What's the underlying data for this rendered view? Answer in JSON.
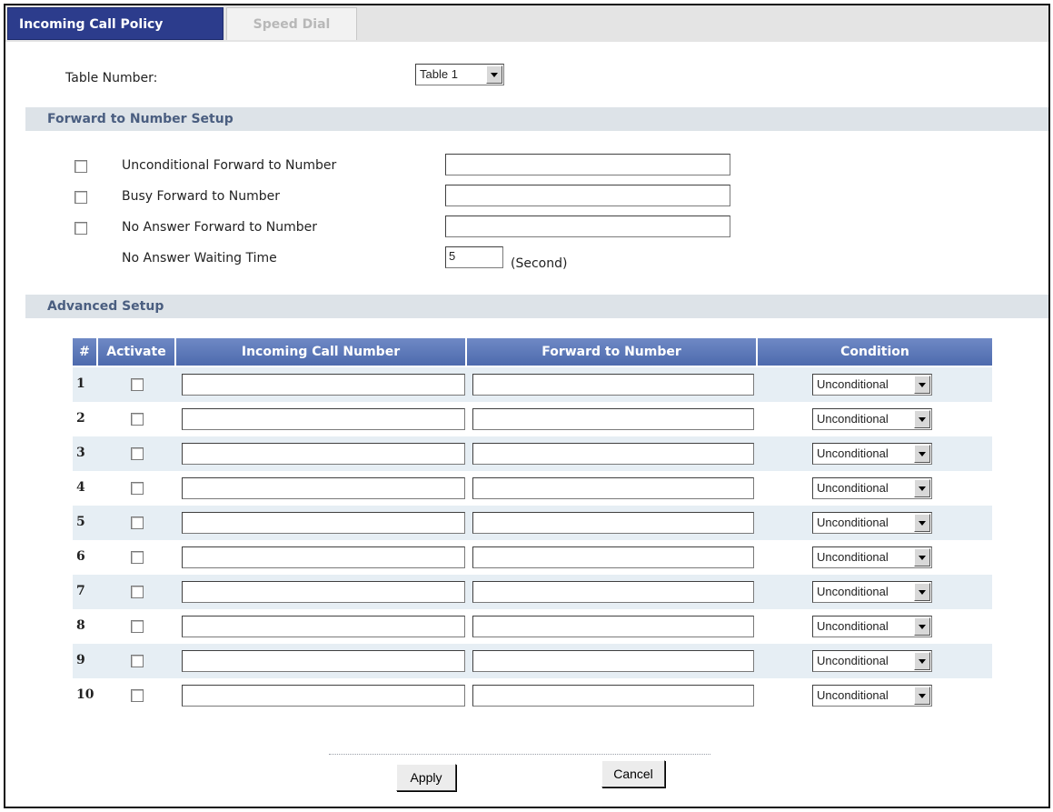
{
  "tabs": [
    {
      "label": "Incoming Call Policy",
      "active": true
    },
    {
      "label": "Speed Dial",
      "active": false
    }
  ],
  "table_number": {
    "label": "Table Number:",
    "value": "Table 1"
  },
  "forward_section": {
    "title": "Forward to Number Setup",
    "unconditional_label": "Unconditional Forward to Number",
    "busy_label": "Busy Forward to Number",
    "no_answer_label": "No Answer Forward to Number",
    "wait_label": "No Answer Waiting Time",
    "wait_value": "5",
    "wait_unit": "(Second)"
  },
  "advanced_section": {
    "title": "Advanced Setup",
    "columns": [
      "#",
      "Activate",
      "Incoming Call Number",
      "Forward to Number",
      "Condition"
    ],
    "rows": [
      {
        "num": "1",
        "condition": "Unconditional"
      },
      {
        "num": "2",
        "condition": "Unconditional"
      },
      {
        "num": "3",
        "condition": "Unconditional"
      },
      {
        "num": "4",
        "condition": "Unconditional"
      },
      {
        "num": "5",
        "condition": "Unconditional"
      },
      {
        "num": "6",
        "condition": "Unconditional"
      },
      {
        "num": "7",
        "condition": "Unconditional"
      },
      {
        "num": "8",
        "condition": "Unconditional"
      },
      {
        "num": "9",
        "condition": "Unconditional"
      },
      {
        "num": "10",
        "condition": "Unconditional"
      }
    ]
  },
  "buttons": {
    "apply": "Apply",
    "cancel": "Cancel"
  }
}
